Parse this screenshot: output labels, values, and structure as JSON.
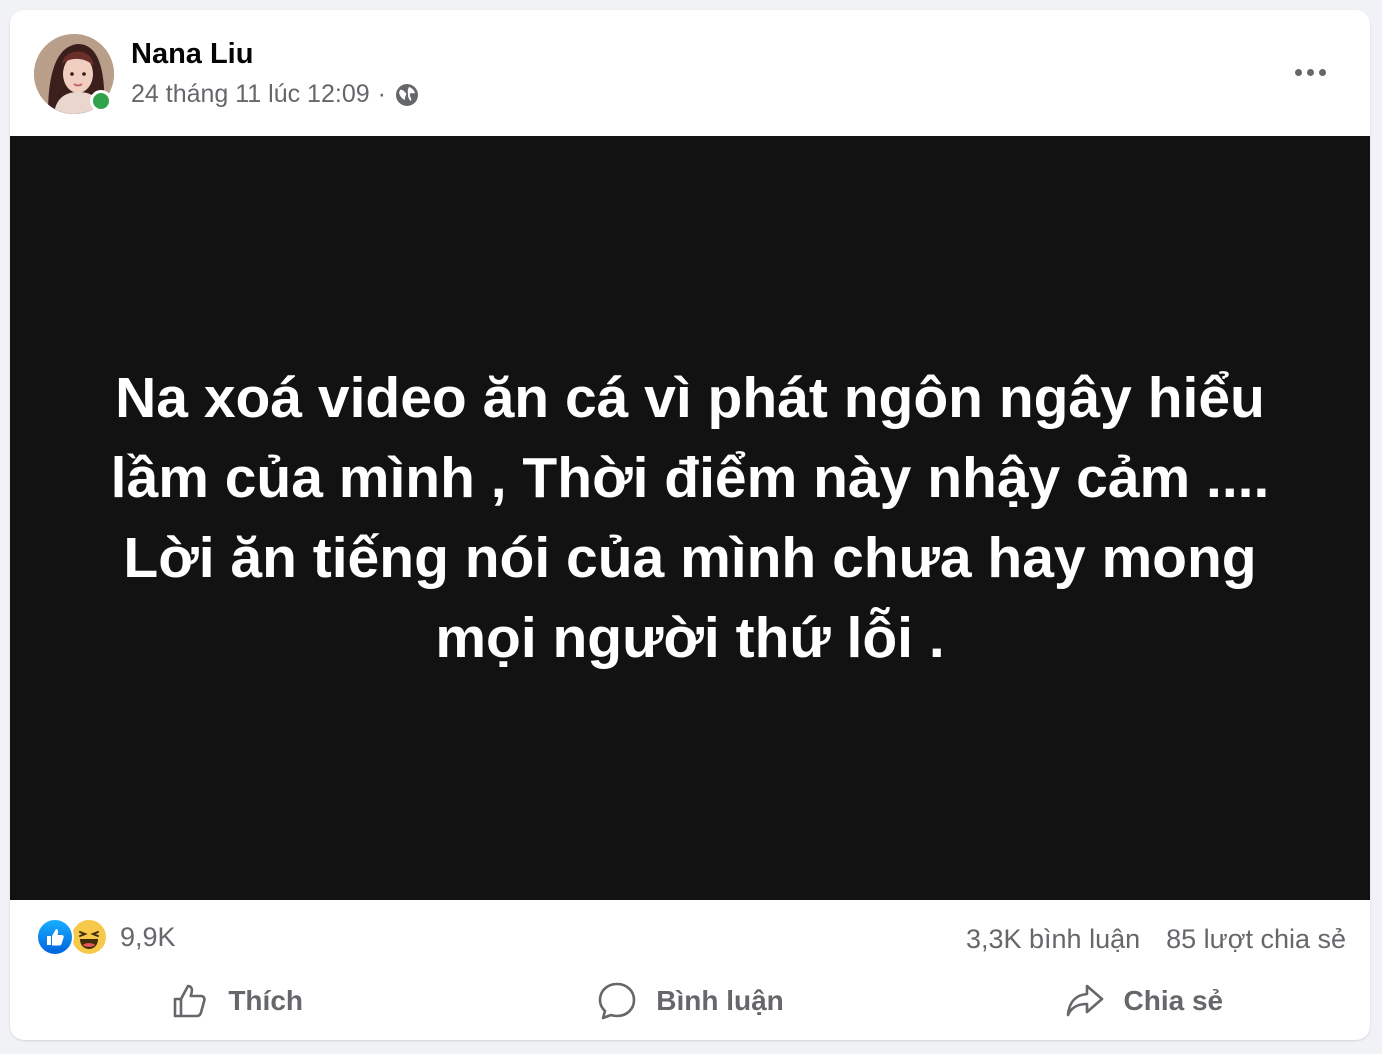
{
  "post": {
    "author": "Nana Liu",
    "timestamp": "24 tháng 11 lúc 12:09",
    "separator": "·",
    "audience_icon": "globe-icon",
    "online": true,
    "more_icon": "more-options-icon",
    "content_lines": [
      "Na xoá video ăn cá vì phát ngôn ngây hiểu",
      "lầm của mình , Thời điểm này nhậy cảm ....",
      "Lời ăn tiếng nói của mình chưa hay mong",
      "mọi người thứ lỗi ."
    ]
  },
  "stats": {
    "reactions_count": "9,9K",
    "reaction_icons": [
      "like-reaction-icon",
      "haha-reaction-icon"
    ],
    "comments": "3,3K bình luận",
    "shares": "85 lượt chia sẻ"
  },
  "actions": {
    "like_label": "Thích",
    "comment_label": "Bình luận",
    "share_label": "Chia sẻ"
  },
  "colors": {
    "background": "#f0f2f5",
    "card": "#ffffff",
    "media_bg": "#121212",
    "secondary_text": "#65676b",
    "online_green": "#31a24c",
    "like_blue": "#0866ff"
  }
}
